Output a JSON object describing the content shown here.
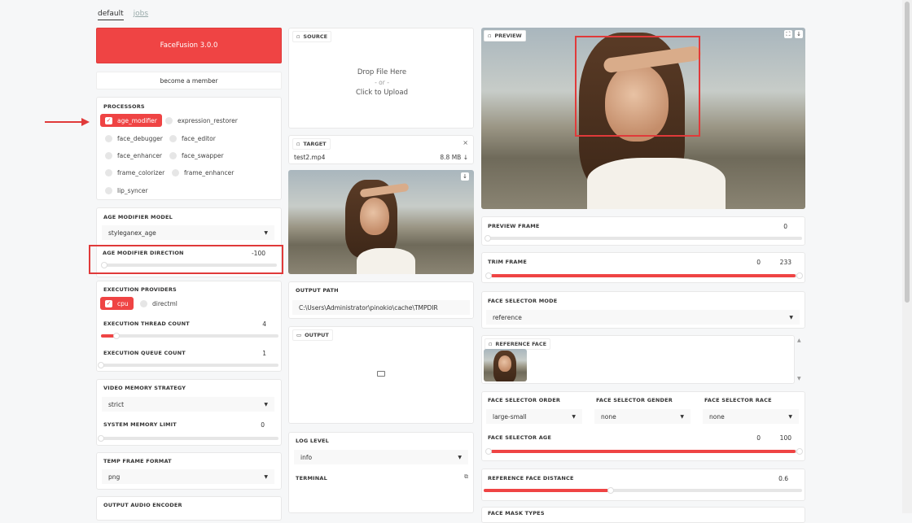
{
  "tabs": [
    {
      "label": "default"
    },
    {
      "label": "jobs"
    }
  ],
  "left": {
    "app_button": "FaceFusion 3.0.0",
    "member_button": "become a member",
    "processors": {
      "title": "PROCESSORS",
      "items": [
        "age_modifier",
        "expression_restorer",
        "face_debugger",
        "face_editor",
        "face_enhancer",
        "face_swapper",
        "frame_colorizer",
        "frame_enhancer",
        "lip_syncer"
      ],
      "checked": "age_modifier"
    },
    "age_model": {
      "title": "AGE MODIFIER MODEL",
      "value": "styleganex_age"
    },
    "age_direction": {
      "title": "AGE MODIFIER DIRECTION",
      "value": "-100",
      "level": 0
    },
    "execution": {
      "title": "EXECUTION PROVIDERS",
      "providers": [
        "cpu",
        "directml"
      ],
      "thread_title": "EXECUTION THREAD COUNT",
      "thread_value": "4",
      "queue_title": "EXECUTION QUEUE COUNT",
      "queue_value": "1"
    },
    "memory": {
      "title": "VIDEO MEMORY STRATEGY",
      "value": "strict",
      "limit_title": "SYSTEM MEMORY LIMIT",
      "limit_value": "0"
    },
    "temp": {
      "title": "TEMP FRAME FORMAT",
      "value": "png"
    },
    "audio": {
      "title": "OUTPUT AUDIO ENCODER"
    }
  },
  "middle": {
    "source": {
      "title": "SOURCE",
      "drop": "Drop File Here",
      "or": "- or -",
      "click": "Click to Upload"
    },
    "target": {
      "title": "TARGET",
      "filename": "test2.mp4",
      "size": "8.8 MB ↓"
    },
    "output_path": {
      "title": "OUTPUT PATH",
      "value": "C:\\Users\\Administrator\\pinokio\\cache\\TMPDIR"
    },
    "output": {
      "title": "OUTPUT"
    },
    "log": {
      "title": "LOG LEVEL",
      "value": "info"
    },
    "terminal": {
      "title": "TERMINAL"
    }
  },
  "right": {
    "preview": {
      "title": "PREVIEW"
    },
    "preview_frame": {
      "title": "PREVIEW FRAME",
      "value": "0"
    },
    "trim_frame": {
      "title": "TRIM FRAME",
      "start": "0",
      "end": "233"
    },
    "selector_mode": {
      "title": "FACE SELECTOR MODE",
      "value": "reference"
    },
    "reference_face": {
      "title": "REFERENCE FACE"
    },
    "selector_order": {
      "title": "FACE SELECTOR ORDER",
      "value": "large-small"
    },
    "selector_gender": {
      "title": "FACE SELECTOR GENDER",
      "value": "none"
    },
    "selector_race": {
      "title": "FACE SELECTOR RACE",
      "value": "none"
    },
    "selector_age": {
      "title": "FACE SELECTOR AGE",
      "min": "0",
      "max": "100"
    },
    "ref_distance": {
      "title": "REFERENCE FACE DISTANCE",
      "value": "0.6"
    },
    "mask_types": {
      "title": "FACE MASK TYPES"
    }
  },
  "colors": {
    "accent": "#ef4444",
    "highlight": "#e03a3a"
  }
}
